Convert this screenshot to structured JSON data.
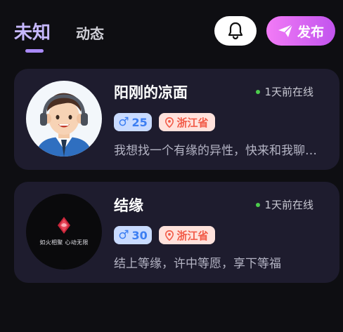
{
  "header": {
    "tabs": [
      {
        "label": "未知",
        "active": true
      },
      {
        "label": "动态",
        "active": false
      }
    ],
    "bell_icon": "bell-icon",
    "publish_button": {
      "label": "发布",
      "icon": "send-icon"
    }
  },
  "users": [
    {
      "name": "阳刚的凉面",
      "online": "1天前在线",
      "gender_icon": "male-icon",
      "age": "25",
      "location": "浙江省",
      "signature": "我想找一个有缘的异性，快来和我聊天吧",
      "avatar": "cartoon-boy-headphones"
    },
    {
      "name": "结缘",
      "online": "1天前在线",
      "gender_icon": "male-icon",
      "age": "30",
      "location": "浙江省",
      "signature": "结上等缘，许中等愿，享下等福",
      "avatar": "logo-avatar",
      "avatar_text": "如火相聚 心动无限"
    }
  ],
  "colors": {
    "background": "#0e0e12",
    "card": "#1e1c2e",
    "tab_active": "#c6b8ff",
    "publish_gradient_start": "#f27bf6",
    "publish_gradient_end": "#c254ee",
    "age_badge_bg": "#c9dbff",
    "age_badge_fg": "#3c7ef2",
    "location_badge_bg": "#ffe2dc",
    "location_badge_fg": "#f25c49",
    "online_dot": "#4ccd4c"
  }
}
